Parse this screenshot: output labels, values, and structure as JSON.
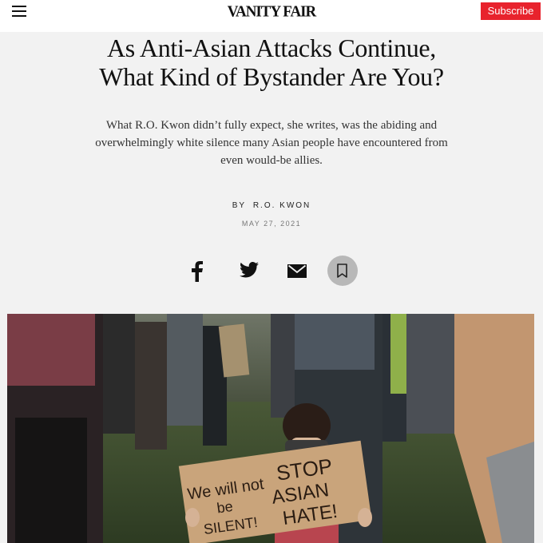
{
  "header": {
    "logo_text": "VANITY FAIR",
    "subscribe_label": "Subscribe",
    "menu_icon": "hamburger-icon"
  },
  "article": {
    "headline_line1": "As Anti-Asian Attacks Continue,",
    "headline_line2": "What Kind of Bystander Are You?",
    "dek": "What R.O. Kwon didn’t fully expect, she writes, was the abiding and overwhelmingly white silence many Asian people have encountered from even would-be allies.",
    "byline_prefix": "BY",
    "author": "R.O. KWON",
    "date": "MAY 27, 2021"
  },
  "share": {
    "icons": [
      "facebook-icon",
      "twitter-icon",
      "email-icon",
      "bookmark-icon"
    ]
  },
  "photo": {
    "sign_left_line1": "We will not",
    "sign_left_line2": "be",
    "sign_left_line3": "SILENT!",
    "sign_right_line1": "STOP",
    "sign_right_line2": "ASIAN",
    "sign_right_line3": "HATE!"
  },
  "colors": {
    "accent": "#e8232d",
    "background": "#f2f2f2"
  }
}
